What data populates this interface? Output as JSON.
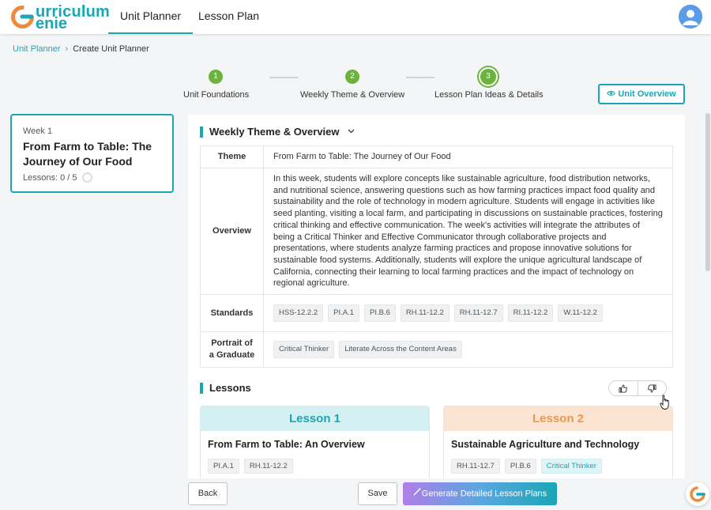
{
  "app": {
    "logo_line1": "urriculum",
    "logo_line2": "enie",
    "brand_color": "#1aa6b5"
  },
  "nav": {
    "tabs": [
      {
        "label": "Unit Planner",
        "active": true
      },
      {
        "label": "Lesson Plan",
        "active": false
      }
    ]
  },
  "breadcrumb": {
    "root": "Unit Planner",
    "current": "Create Unit Planner"
  },
  "stepper": {
    "steps": [
      {
        "number": "1",
        "label": "Unit Foundations"
      },
      {
        "number": "2",
        "label": "Weekly Theme & Overview"
      },
      {
        "number": "3",
        "label": "Lesson Plan Ideas & Details",
        "current": true
      }
    ],
    "step_color": "#6cb33e"
  },
  "unit_overview_button": "Unit Overview",
  "week_card": {
    "week": "Week 1",
    "title": "From Farm to Table: The Journey of Our Food",
    "lessons": "Lessons: 0 / 5"
  },
  "weekly_section": {
    "title": "Weekly Theme & Overview",
    "theme_label": "Theme",
    "theme_value": "From Farm to Table: The Journey of Our Food",
    "overview_label": "Overview",
    "overview_value": "In this week, students will explore concepts like sustainable agriculture, food distribution networks, and nutritional science, answering questions such as how farming practices impact food quality and sustainability and the role of technology in modern agriculture. Students will engage in activities like seed planting, visiting a local farm, and participating in discussions on sustainable practices, fostering critical thinking and effective communication. The week's activities will integrate the attributes of being a Critical Thinker and Effective Communicator through collaborative projects and presentations, where students analyze farming practices and propose innovative solutions for sustainable food systems. Additionally, students will explore the unique agricultural landscape of California, connecting their learning to local farming practices and the impact of technology on regional agriculture.",
    "standards_label": "Standards",
    "standards": [
      "HSS-12.2.2",
      "PI.A.1",
      "PI.B.6",
      "RH.11-12.2",
      "RH.11-12.7",
      "RI.11-12.2",
      "W.11-12.2"
    ],
    "portrait_label_1": "Portrait of",
    "portrait_label_2": "a Graduate",
    "portrait": [
      "Critical Thinker",
      "Literate Across the Content Areas"
    ]
  },
  "lessons_section": {
    "title": "Lessons",
    "lessons": [
      {
        "heading": "Lesson 1",
        "title": "From Farm to Table: An Overview",
        "chips": [
          "PI.A.1",
          "RH.11-12.2"
        ],
        "head_bg": "#d5f0f3",
        "head_color": "#1aa6b5"
      },
      {
        "heading": "Lesson 2",
        "title": "Sustainable Agriculture and Technology",
        "chips": [
          "RH.11-12.7",
          "PI.B.6"
        ],
        "teal_chip": "Critical Thinker",
        "head_bg": "#fbe5d2",
        "head_color": "#e79a4c"
      }
    ]
  },
  "footer": {
    "back": "Back",
    "save": "Save",
    "generate": "Generate Detailed Lesson Plans"
  }
}
